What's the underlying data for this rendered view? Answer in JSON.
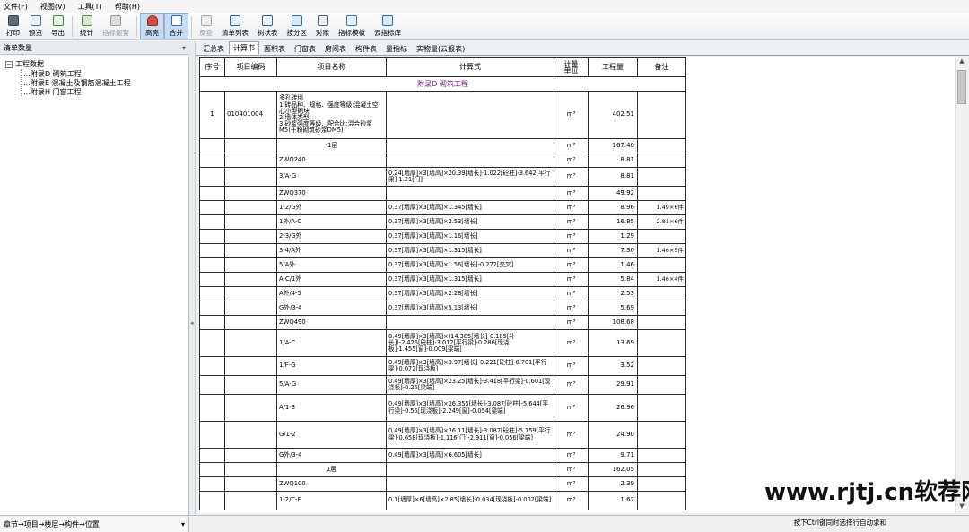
{
  "menu": [
    "文件(F)",
    "视图(V)",
    "工具(T)",
    "帮助(H)"
  ],
  "toolbar": [
    {
      "label": "打印",
      "icon": "print-icon",
      "cls": "print",
      "state": "normal"
    },
    {
      "label": "预览",
      "icon": "preview-icon",
      "cls": "preview",
      "state": "normal"
    },
    {
      "label": "导出",
      "icon": "export-icon",
      "cls": "export",
      "state": "normal"
    },
    {
      "label": "统计",
      "icon": "statistics-icon",
      "cls": "stats",
      "state": "normal"
    },
    {
      "label": "指标报警",
      "icon": "indicator-alarm-icon",
      "cls": "indicator",
      "state": "disabled"
    },
    {
      "label": "高亮",
      "icon": "highlight-icon",
      "cls": "highlight",
      "state": "active"
    },
    {
      "label": "合并",
      "icon": "merge-icon",
      "cls": "merge",
      "state": "active"
    },
    {
      "label": "反查",
      "icon": "reverse-lookup-icon",
      "cls": "reverse",
      "state": "disabled"
    },
    {
      "label": "清单列表",
      "icon": "bill-list-icon",
      "cls": "list",
      "state": "normal"
    },
    {
      "label": "树状表",
      "icon": "tree-table-icon",
      "cls": "tree",
      "state": "normal"
    },
    {
      "label": "按分区",
      "icon": "by-zone-icon",
      "cls": "zone",
      "state": "normal"
    },
    {
      "label": "对账",
      "icon": "reconcile-icon",
      "cls": "account",
      "state": "normal"
    },
    {
      "label": "指标模板",
      "icon": "indicator-template-icon",
      "cls": "template",
      "state": "normal"
    },
    {
      "label": "云指标库",
      "icon": "cloud-indicator-icon",
      "cls": "cloud",
      "state": "normal"
    }
  ],
  "left_panel": {
    "title": "清单数量",
    "pin": "▾",
    "tree_root": "工程数据",
    "tree_children": [
      "附录D 砌筑工程",
      "附录E 混凝土及钢筋混凝土工程",
      "附录H 门窗工程"
    ]
  },
  "tabs": [
    "汇总表",
    "计算书",
    "面积表",
    "门窗表",
    "房间表",
    "构件表",
    "量指标",
    "实物量(云报表)"
  ],
  "selected_tab": "计算书",
  "table": {
    "headers": [
      "序号",
      "项目编码",
      "项目名称",
      "计算式",
      "计量\n单位",
      "工程量",
      "备注"
    ],
    "chapter": "附录D 砌筑工程",
    "rows": [
      {
        "seq": "1",
        "code": "010401004",
        "name": "多孔砖墙\n1.砖品种、规格、强度等级:混凝土空心小型砌块\n2.墙体类型:\n3.砂浆强度等级、配合比:混合砂浆M5(干粉砌筑砂浆DM5)",
        "formula": "",
        "unit": "m³",
        "qty": "402.51",
        "note": "",
        "h": 53
      },
      {
        "seq": "",
        "code": "",
        "name": "-1层",
        "formula": "",
        "unit": "m³",
        "qty": "167.40",
        "note": "",
        "h": 16,
        "center": true
      },
      {
        "seq": "",
        "code": "",
        "name": "ZWQ240",
        "formula": "",
        "unit": "m³",
        "qty": "8.81",
        "note": "",
        "h": 16
      },
      {
        "seq": "",
        "code": "",
        "name": "3/A-G",
        "formula": "0.24[墙厚]×3[墙高]×20.39[墙长]-1.022[砼柱]-3.642[平行梁]-1.21[门]",
        "unit": "m³",
        "qty": "8.81",
        "note": "",
        "h": 21
      },
      {
        "seq": "",
        "code": "",
        "name": "ZWQ370",
        "formula": "",
        "unit": "m³",
        "qty": "49.92",
        "note": "",
        "h": 16
      },
      {
        "seq": "",
        "code": "",
        "name": "1-2/G外",
        "formula": "0.37[墙厚]×3[墙高]×1.345[墙长]",
        "unit": "m³",
        "qty": "8.96",
        "note": "1.49×6件",
        "h": 16
      },
      {
        "seq": "",
        "code": "",
        "name": "1外/A-C",
        "formula": "0.37[墙厚]×3[墙高]×2.53[墙长]",
        "unit": "m³",
        "qty": "16.85",
        "note": "2.81×6件",
        "h": 16
      },
      {
        "seq": "",
        "code": "",
        "name": "2-3/G外",
        "formula": "0.37[墙厚]×3[墙高]×1.16[墙长]",
        "unit": "m³",
        "qty": "1.29",
        "note": "",
        "h": 16
      },
      {
        "seq": "",
        "code": "",
        "name": "3-4/A外",
        "formula": "0.37[墙厚]×3[墙高]×1.315[墙长]",
        "unit": "m³",
        "qty": "7.30",
        "note": "1.46×5件",
        "h": 16
      },
      {
        "seq": "",
        "code": "",
        "name": "5/A外",
        "formula": "0.37[墙厚]×3[墙高]×1.56[墙长]-0.272[交叉]",
        "unit": "m³",
        "qty": "1.46",
        "note": "",
        "h": 16
      },
      {
        "seq": "",
        "code": "",
        "name": "A-C/1外",
        "formula": "0.37[墙厚]×3[墙高]×1.315[墙长]",
        "unit": "m³",
        "qty": "5.84",
        "note": "1.46×4件",
        "h": 16
      },
      {
        "seq": "",
        "code": "",
        "name": "A外/4-5",
        "formula": "0.37[墙厚]×3[墙高]×2.28[墙长]",
        "unit": "m³",
        "qty": "2.53",
        "note": "",
        "h": 16
      },
      {
        "seq": "",
        "code": "",
        "name": "G外/3-4",
        "formula": "0.37[墙厚]×3[墙高]×5.13[墙长]",
        "unit": "m³",
        "qty": "5.69",
        "note": "",
        "h": 16
      },
      {
        "seq": "",
        "code": "",
        "name": "ZWQ490",
        "formula": "",
        "unit": "m³",
        "qty": "108.68",
        "note": "",
        "h": 16
      },
      {
        "seq": "",
        "code": "",
        "name": "1/A-C",
        "formula": "0.49[墙厚]×3[墙高]×(14.385[墙长]-0.185[补长])-2.426[砼柱]-3.012[平行梁]-0.286[现浇板]-1.455[窗]-0.009[梁端]",
        "unit": "m³",
        "qty": "13.69",
        "note": "",
        "h": 30
      },
      {
        "seq": "",
        "code": "",
        "name": "1/F-G",
        "formula": "0.49[墙厚]×3[墙高]×3.97[墙长]-0.221[砼柱]-0.701[平行梁]-0.072[现浇板]",
        "unit": "m³",
        "qty": "3.52",
        "note": "",
        "h": 21
      },
      {
        "seq": "",
        "code": "",
        "name": "5/A-G",
        "formula": "0.49[墙厚]×3[墙高]×23.25[墙长]-3.418[平行梁]-0.601[现浇板]-0.25[梁端]",
        "unit": "m³",
        "qty": "29.91",
        "note": "",
        "h": 21
      },
      {
        "seq": "",
        "code": "",
        "name": "A/1-3",
        "formula": "0.49[墙厚]×3[墙高]×26.355[墙长]-3.087[砼柱]-5.644[平行梁]-0.55[现浇板]-2.249[窗]-0.054[梁端]",
        "unit": "m³",
        "qty": "26.96",
        "note": "",
        "h": 30
      },
      {
        "seq": "",
        "code": "",
        "name": "G/1-2",
        "formula": "0.49[墙厚]×3[墙高]×26.11[墙长]-3.087[砼柱]-5.759[平行梁]-0.658[现浇板]-1.116[门]-2.911[窗]-0.056[梁端]",
        "unit": "m³",
        "qty": "24.90",
        "note": "",
        "h": 30
      },
      {
        "seq": "",
        "code": "",
        "name": "G外/3-4",
        "formula": "0.49[墙厚]×3[墙高]×6.605[墙长]",
        "unit": "m³",
        "qty": "9.71",
        "note": "",
        "h": 16
      },
      {
        "seq": "",
        "code": "",
        "name": "1层",
        "formula": "",
        "unit": "m³",
        "qty": "162.05",
        "note": "",
        "h": 16,
        "center": true
      },
      {
        "seq": "",
        "code": "",
        "name": "ZWQ100",
        "formula": "",
        "unit": "m³",
        "qty": "2.39",
        "note": "",
        "h": 16
      },
      {
        "seq": "",
        "code": "",
        "name": "1-2/C-F",
        "formula": "0.1[墙厚]×6[墙高]×2.85[墙长]-0.034[现浇板]-0.002[梁端]",
        "unit": "m³",
        "qty": "1.67",
        "note": "",
        "h": 21
      }
    ]
  },
  "status": {
    "path": "章节→项目→楼层→构件→位置",
    "hint": "按下Ctrl键同时选择行自动求和"
  },
  "watermark": "www.rjtj.cn软荐网"
}
